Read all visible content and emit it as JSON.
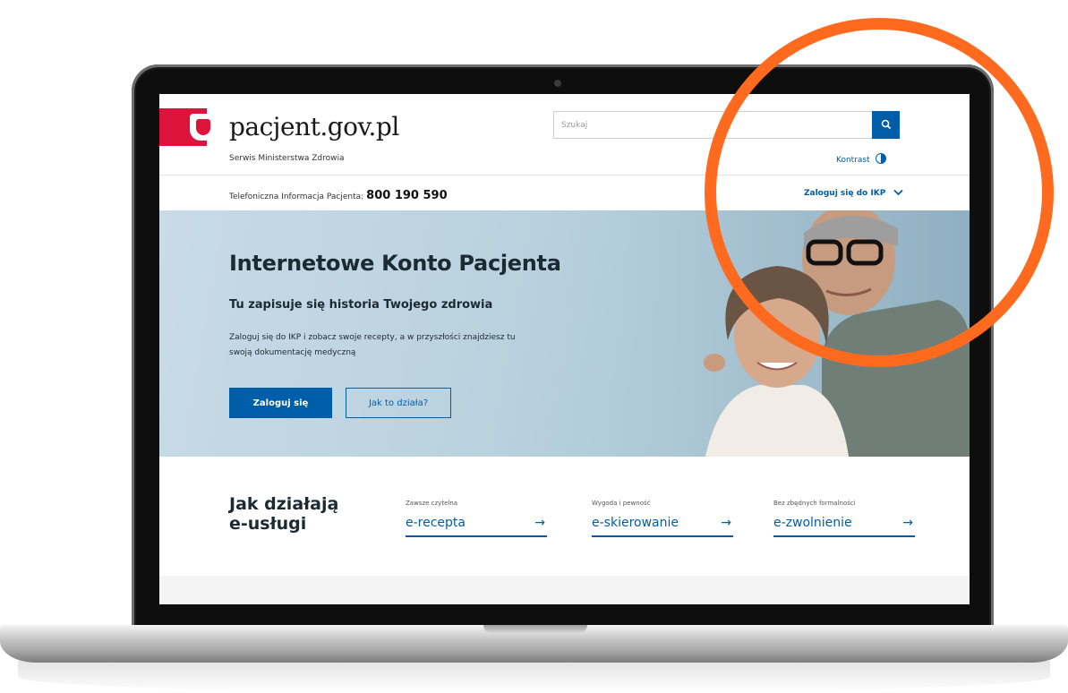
{
  "header": {
    "logo_text": "pacjent.gov.pl",
    "tagline": "Serwis Ministerstwa Zdrowia",
    "search_placeholder": "Szukaj",
    "contrast_label": "Kontrast",
    "info_label": "Telefoniczna Informacja Pacjenta:",
    "phone": "800 190 590",
    "ikp_login_label": "Zaloguj się do IKP"
  },
  "hero": {
    "title": "Internetowe Konto Pacjenta",
    "subtitle": "Tu zapisuje się historia Twojego zdrowia",
    "description": "Zaloguj się do IKP i zobacz swoje recepty, a w przyszłości znajdziesz tu swoją dokumentację medyczną",
    "primary_button": "Zaloguj się",
    "secondary_button": "Jak to działa?"
  },
  "services": {
    "title": "Jak działają e-usługi",
    "items": [
      {
        "caption": "Zawsze czytelna",
        "label": "e-recepta",
        "arrow": "→"
      },
      {
        "caption": "Wygoda i pewność",
        "label": "e-skierowanie",
        "arrow": "→"
      },
      {
        "caption": "Bez zbędnych formalności",
        "label": "e-zwolnienie",
        "arrow": "→"
      }
    ]
  },
  "colors": {
    "accent": "#005ea8",
    "brand_red": "#dc143c",
    "highlight": "#ff6a1f"
  },
  "icons": [
    "polish-eagle-emblem-icon",
    "search-icon",
    "contrast-icon",
    "chevron-down-icon",
    "arrow-right-icon"
  ]
}
